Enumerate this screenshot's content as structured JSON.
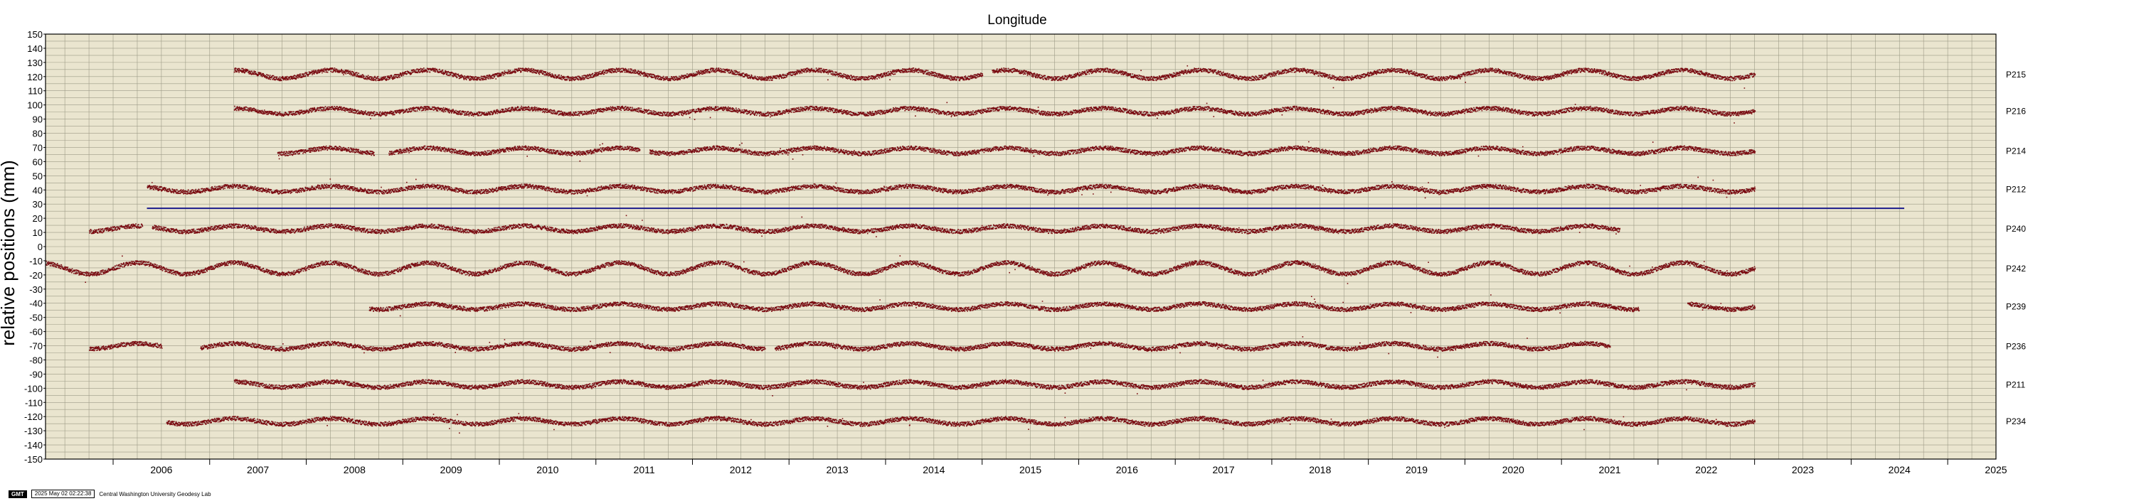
{
  "colors": {
    "background": "#eae5cf",
    "grid": "#9c9a86",
    "points": "#7a0a10",
    "model": "#c8c4b4",
    "hline": "#1a1a8c"
  },
  "footer": {
    "logo": "GMT",
    "timestamp": "2025 May 02 02:22:38",
    "institution": "Central Washington University Geodesy Lab"
  },
  "chart_data": {
    "type": "scatter",
    "title": "Longitude",
    "xlabel": "",
    "ylabel": "relative positions (mm)",
    "xlim": [
      2005.3,
      2025.5
    ],
    "ylim": [
      -150,
      150
    ],
    "xticks": [
      "2006",
      "2007",
      "2008",
      "2009",
      "2010",
      "2011",
      "2012",
      "2013",
      "2014",
      "2015",
      "2016",
      "2017",
      "2018",
      "2019",
      "2020",
      "2021",
      "2022",
      "2023",
      "2024",
      "2025"
    ],
    "yticks": [
      150,
      140,
      130,
      120,
      110,
      100,
      90,
      80,
      70,
      60,
      50,
      40,
      30,
      20,
      10,
      0,
      -10,
      -20,
      -30,
      -40,
      -50,
      -60,
      -70,
      -80,
      -90,
      -100,
      -110,
      -120,
      -130,
      -140,
      -150
    ],
    "grid": true,
    "reference_line": {
      "y": 27,
      "x_start": 2006.35,
      "x_end": 2024.55
    },
    "series": [
      {
        "name": "P215",
        "offset": 122,
        "start": 2007.25,
        "end": 2023.0,
        "gaps": [
          [
            2015.0,
            2015.1
          ]
        ],
        "amp": 3
      },
      {
        "name": "P216",
        "offset": 96,
        "start": 2007.25,
        "end": 2023.0,
        "gaps": [],
        "amp": 2
      },
      {
        "name": "P214",
        "offset": 68,
        "start": 2007.7,
        "end": 2023.0,
        "gaps": [
          [
            2008.7,
            2008.85
          ],
          [
            2011.45,
            2011.55
          ]
        ],
        "amp": 2
      },
      {
        "name": "P212",
        "offset": 41,
        "start": 2006.35,
        "end": 2023.0,
        "gaps": [],
        "amp": 2
      },
      {
        "name": "P240",
        "offset": 13,
        "start": 2005.75,
        "end": 2021.6,
        "gaps": [
          [
            2006.3,
            2006.4
          ]
        ],
        "amp": 2
      },
      {
        "name": "P242",
        "offset": -15,
        "start": 2005.3,
        "end": 2023.0,
        "gaps": [],
        "amp": 4
      },
      {
        "name": "P239",
        "offset": -42,
        "start": 2008.65,
        "end": 2023.0,
        "gaps": [
          [
            2021.8,
            2022.3
          ]
        ],
        "amp": 2
      },
      {
        "name": "P236",
        "offset": -70,
        "start": 2005.75,
        "end": 2021.5,
        "gaps": [
          [
            2006.5,
            2006.9
          ],
          [
            2012.75,
            2012.85
          ]
        ],
        "amp": 2
      },
      {
        "name": "P211",
        "offset": -97,
        "start": 2007.25,
        "end": 2023.0,
        "gaps": [],
        "amp": 2
      },
      {
        "name": "P234",
        "offset": -123,
        "start": 2006.55,
        "end": 2023.0,
        "gaps": [],
        "amp": 2
      }
    ]
  }
}
